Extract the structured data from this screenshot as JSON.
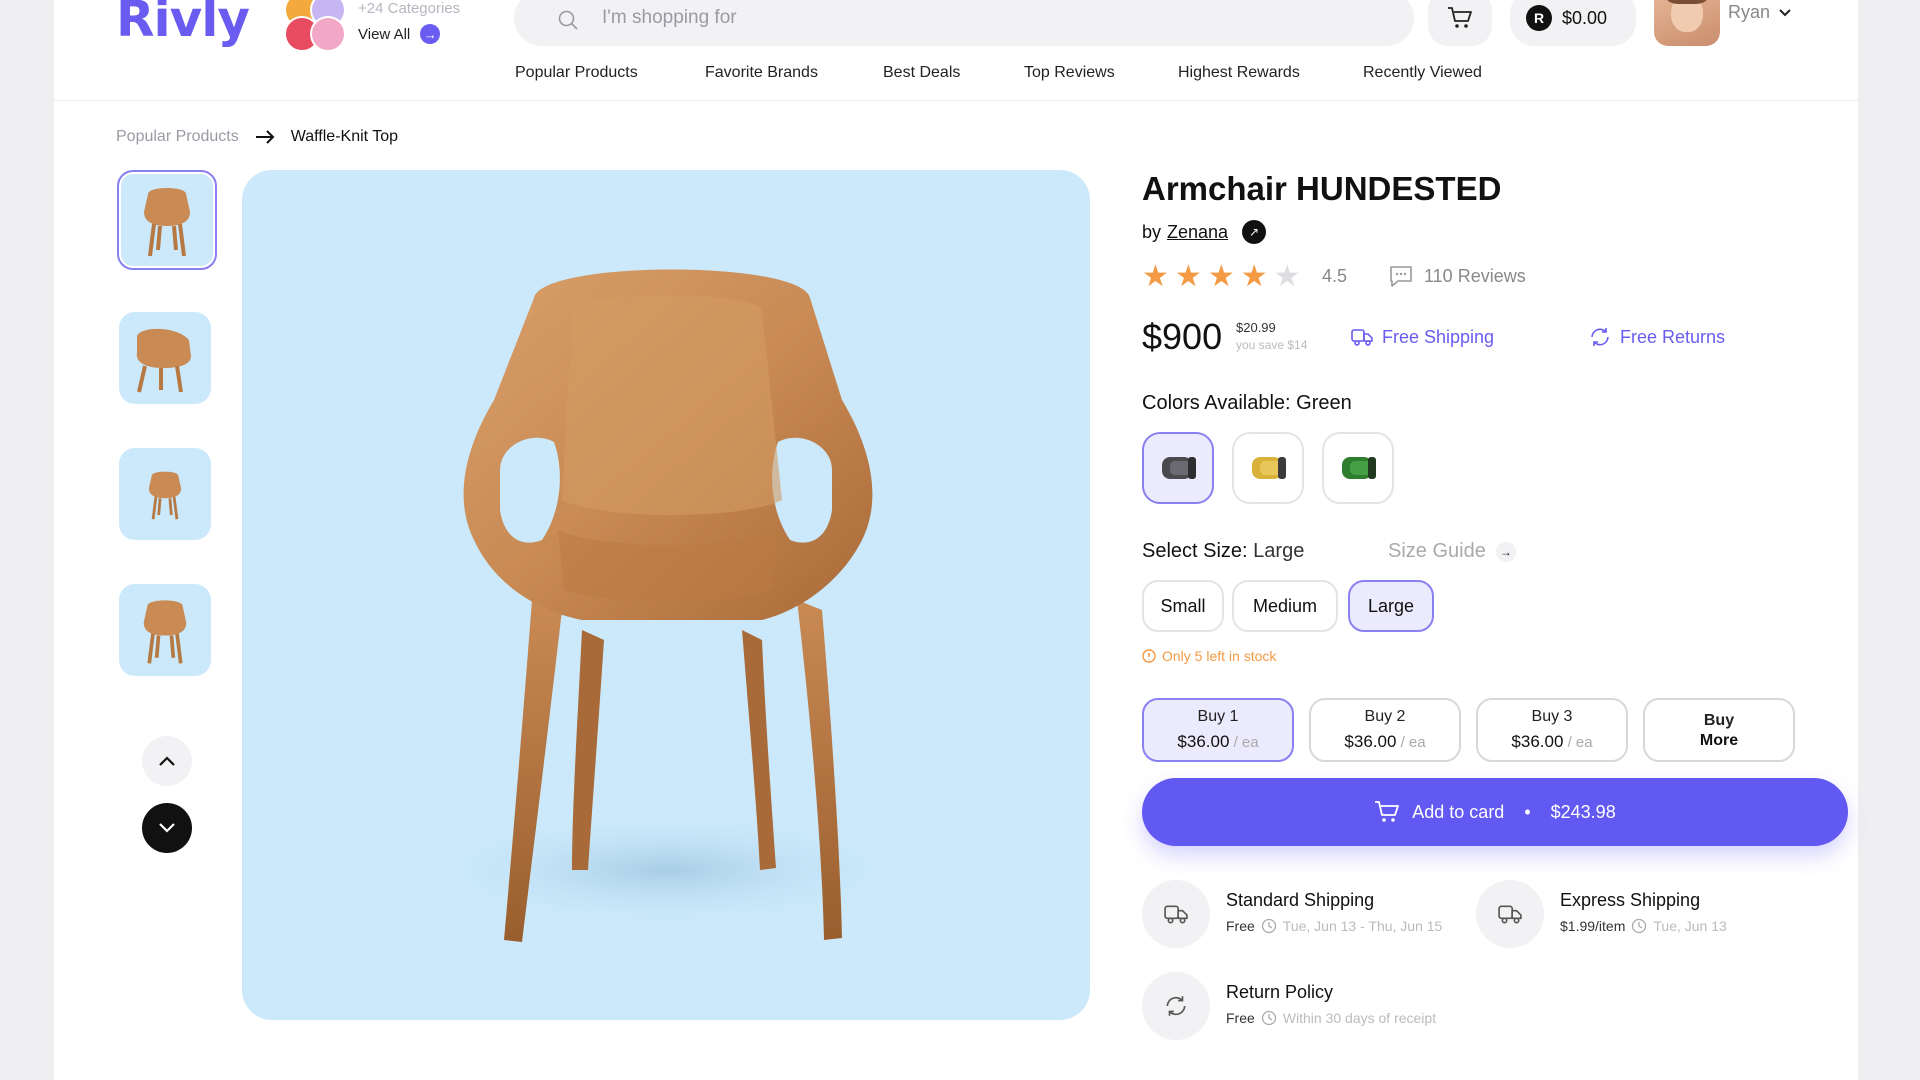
{
  "brand": {
    "logo": "Rivly"
  },
  "categories": {
    "count_label": "+24 Categories",
    "view_all": "View All"
  },
  "search": {
    "placeholder": "I'm shopping for"
  },
  "wallet": {
    "coin": "R",
    "balance": "$0.00"
  },
  "user": {
    "name": "Ryan"
  },
  "nav": [
    "Popular Products",
    "Favorite Brands",
    "Best Deals",
    "Top Reviews",
    "Highest Rewards",
    "Recently Viewed"
  ],
  "breadcrumb": {
    "parent": "Popular Products",
    "current": "Waffle-Knit Top"
  },
  "product": {
    "title": "Armchair HUNDESTED",
    "by": "by",
    "brand": "Zenana",
    "rating": "4.5",
    "rating_value": 4.5,
    "reviews": "110 Reviews",
    "price": "$900",
    "old_price": "$20.99",
    "you_save": "you save $14",
    "free_shipping": "Free Shipping",
    "free_returns": "Free Returns"
  },
  "colors": {
    "label": "Colors Available:",
    "selected": "Green",
    "options": [
      "dark-gray",
      "yellow",
      "green"
    ]
  },
  "size": {
    "label": "Select Size:",
    "selected": "Large",
    "guide": "Size Guide",
    "options": [
      "Small",
      "Medium",
      "Large"
    ]
  },
  "stock": {
    "text": "Only 5 left in stock"
  },
  "bundles": [
    {
      "label": "Buy 1",
      "price": "$36.00",
      "unit": " / ea"
    },
    {
      "label": "Buy 2",
      "price": "$36.00",
      "unit": " / ea"
    },
    {
      "label": "Buy 3",
      "price": "$36.00",
      "unit": " / ea"
    },
    {
      "label": "Buy",
      "label2": "More"
    }
  ],
  "cart": {
    "label": "Add to card",
    "dot": "•",
    "total": "$243.98"
  },
  "shipping": [
    {
      "title": "Standard Shipping",
      "cost": "Free",
      "eta": "Tue, Jun 13 - Thu, Jun 15"
    },
    {
      "title": "Express Shipping",
      "cost": "$1.99/item",
      "eta": "Tue, Jun 13"
    },
    {
      "title": "Return Policy",
      "cost": "Free",
      "eta": "Within 30 days of receipt"
    }
  ],
  "colors_hex": {
    "accent": "#6258f2",
    "star": "#f49a44",
    "image_bg": "#cbe9fb"
  }
}
